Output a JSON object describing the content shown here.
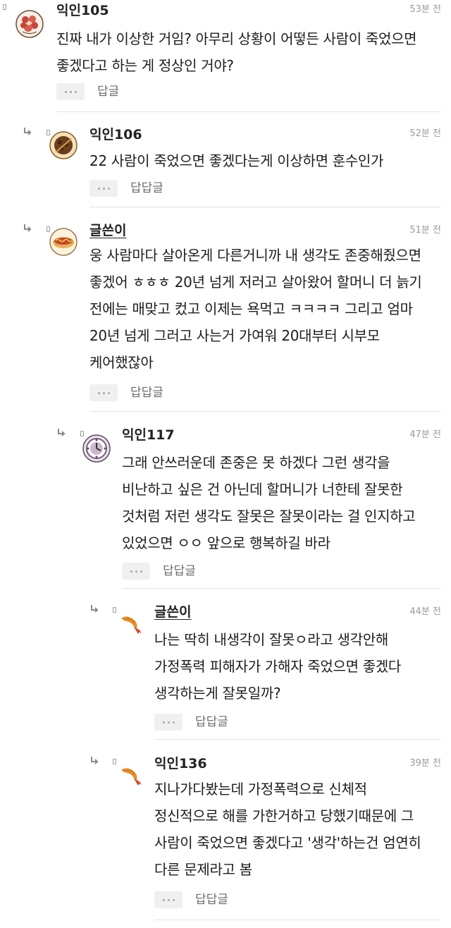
{
  "comments": [
    {
      "author": "익인105",
      "time": "53분 전",
      "text": "진짜 내가 이상한 거임? 아무리 상황이 어떻든 사람이 죽었으면 좋겠다고 하는 게 정상인 거야?",
      "reply_label": "답글",
      "avatar_icon": "flower-avatar-icon",
      "is_op": false
    },
    {
      "author": "익인106",
      "time": "52분 전",
      "text": "22 사람이 죽었으면 좋겠다는게 이상하면 훈수인가",
      "reply_label": "답답글",
      "avatar_icon": "cookie-avatar-icon",
      "is_op": false
    },
    {
      "author": "글쓴이",
      "time": "51분 전",
      "text": "웅 사람마다 살아온게 다른거니까 내 생각도 존중해줬으면 좋겠어 ㅎㅎㅎ 20년 넘게 저러고 살아왔어 할머니 더 늙기 전에는 매맞고 컸고 이제는 욕먹고 ㅋㅋㅋㅋ 그리고 엄마 20년 넘게 그러고 사는거 가여워 20대부터 시부모 케어했잖아",
      "reply_label": "답답글",
      "avatar_icon": "hotdog-avatar-icon",
      "is_op": true
    },
    {
      "author": "익인117",
      "time": "47분 전",
      "text": "그래 안쓰러운데 존중은 못 하겠다 그런 생각을 비난하고 싶은 건 아닌데 할머니가 너한테 잘못한 것처럼 저런 생각도 잘못은 잘못이라는 걸 인지하고 있었으면 ㅇㅇ 앞으로 행복하길 바라",
      "reply_label": "답답글",
      "avatar_icon": "clock-avatar-icon",
      "is_op": false
    },
    {
      "author": "글쓴이",
      "time": "44분 전",
      "text": "나는 딱히 내생각이 잘못ㅇ라고 생각안해 가정폭력 피해자가 가해자 죽었으면 좋겠다 생각하는게 잘못일까?",
      "reply_label": "답답글",
      "avatar_icon": "fried-shrimp-avatar-icon",
      "is_op": true
    },
    {
      "author": "익인136",
      "time": "39분 전",
      "text": "지나가다봤는데 가정폭력으로 신체적 정신적으로 해를 가한거하고 당했기때문에 그 사람이 죽었으면 좋겠다고 '생각'하는건 엄연히 다른 문제라고 봄",
      "reply_label": "답답글",
      "avatar_icon": "fried-shrimp-avatar-icon",
      "is_op": false
    }
  ]
}
